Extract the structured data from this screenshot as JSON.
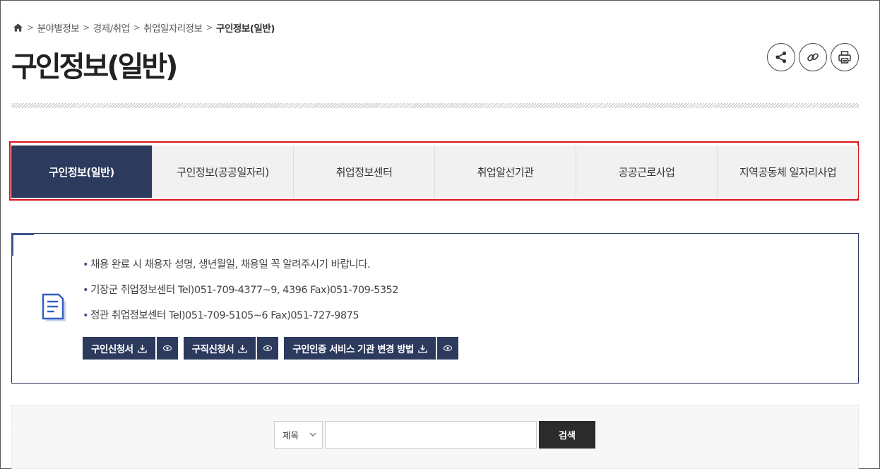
{
  "breadcrumb": {
    "items": [
      "분야별정보",
      "경제/취업",
      "취업일자리정보"
    ],
    "current": "구인정보(일반)"
  },
  "page_title": "구인정보(일반)",
  "tools": {
    "share_icon": "share-icon",
    "link_icon": "link-icon",
    "print_icon": "print-icon"
  },
  "tabs": [
    {
      "label": "구인정보(일반)",
      "active": true
    },
    {
      "label": "구인정보(공공일자리)",
      "active": false
    },
    {
      "label": "취업정보센터",
      "active": false
    },
    {
      "label": "취업알선기관",
      "active": false
    },
    {
      "label": "공공근로사업",
      "active": false
    },
    {
      "label": "지역공동체 일자리사업",
      "active": false
    }
  ],
  "info": {
    "notes": [
      "채용 완료 시 채용자 성명, 생년월일, 채용일 꼭 알려주시기 바랍니다.",
      "기장군 취업정보센터 Tel)051-709-4377~9, 4396    Fax)051-709-5352",
      "정관 취업정보센터 Tel)051-709-5105~6    Fax)051-727-9875"
    ],
    "buttons": [
      {
        "label": "구인신청서"
      },
      {
        "label": "구직신청서"
      },
      {
        "label": "구인인증 서비스 기관 변경 방법"
      }
    ]
  },
  "search": {
    "select_value": "제목",
    "input_value": "",
    "button_label": "검색"
  },
  "colors": {
    "navy": "#2c3a5e",
    "highlight_border": "#d9141a",
    "search_button": "#2b2b2b"
  }
}
